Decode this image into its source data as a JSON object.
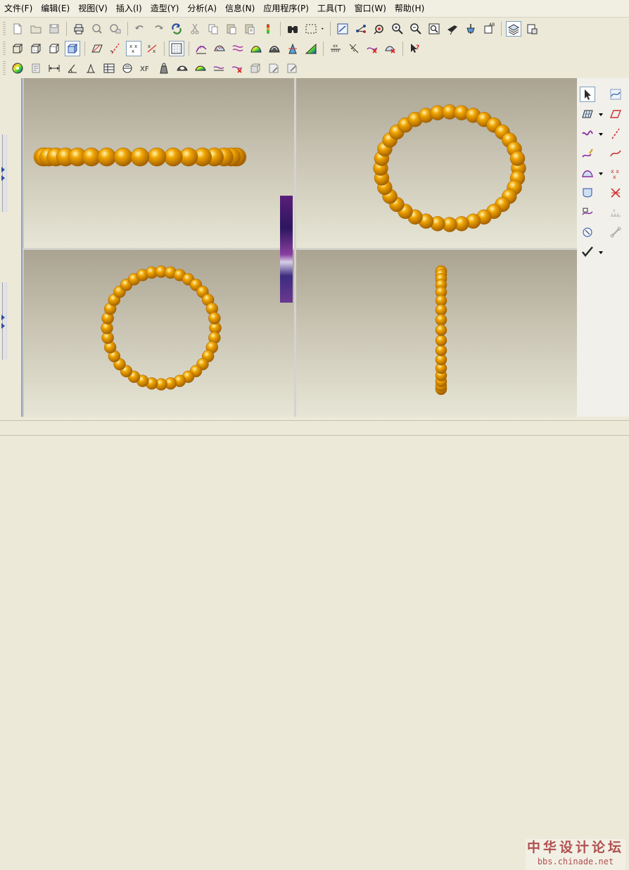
{
  "menu": [
    {
      "id": "file",
      "label": "文件(F)"
    },
    {
      "id": "edit",
      "label": "编辑(E)"
    },
    {
      "id": "view",
      "label": "视图(V)"
    },
    {
      "id": "insert",
      "label": "插入(I)"
    },
    {
      "id": "shape",
      "label": "造型(Y)"
    },
    {
      "id": "analysis",
      "label": "分析(A)"
    },
    {
      "id": "info",
      "label": "信息(N)"
    },
    {
      "id": "apps",
      "label": "应用程序(P)"
    },
    {
      "id": "tools",
      "label": "工具(T)"
    },
    {
      "id": "window",
      "label": "窗口(W)"
    },
    {
      "id": "help",
      "label": "帮助(H)"
    }
  ],
  "toolbars": [
    [
      "new-file",
      "open-folder",
      "save",
      "|",
      "print",
      "print-preview",
      "print-setup",
      "|",
      "undo",
      "redo",
      "regenerate",
      "cut",
      "copy",
      "paste",
      "paste-special",
      "model-player",
      "|",
      "binoculars",
      "selection-box",
      "dropdown",
      "|",
      "zoom-refit",
      "spin-view",
      "orient",
      "zoom-in",
      "zoom-out",
      "zoom-window",
      "fly-through",
      "datum-display",
      "named-view",
      "|",
      "layers",
      "layer-manager"
    ],
    [
      "cube-wire",
      "cube-hidden",
      "cube-nohidden",
      "cube-shaded",
      "|",
      "datum-plane",
      "datum-axis",
      "datum-points",
      "datum-points-off",
      "|",
      "grid-sketch",
      "|",
      "curve-analysis",
      "surface-analysis",
      "curvature",
      "shaded-curvature",
      "reflection",
      "draft-check",
      "slope",
      "|",
      "offset-points",
      "offset-points-off",
      "curve-cross",
      "surface-cross",
      "|",
      "whats-this"
    ],
    [
      "color-wheel",
      "scroll-note",
      "dimension",
      "angle-dim",
      "taper",
      "table-grid",
      "circle-cut",
      "xf-transform",
      "weight",
      "surf-eye",
      "surf-shade",
      "surf-analysis-2",
      "curve-delete",
      "cube-plus",
      "note-edit",
      "note-edit-2"
    ]
  ],
  "rightpanel": [
    {
      "id": "select-arrow",
      "col": 0,
      "row": 0,
      "active": true,
      "dropdown": false
    },
    {
      "id": "style-curve",
      "col": 1,
      "row": 0,
      "active": false,
      "dropdown": false
    },
    {
      "id": "surface-grid",
      "col": 0,
      "row": 1,
      "active": false,
      "dropdown": true
    },
    {
      "id": "plane-tool",
      "col": 1,
      "row": 1,
      "active": false,
      "dropdown": false
    },
    {
      "id": "wave-curve",
      "col": 0,
      "row": 2,
      "active": false,
      "dropdown": true
    },
    {
      "id": "dash-curve",
      "col": 1,
      "row": 2,
      "active": false,
      "dropdown": false
    },
    {
      "id": "pen-curve",
      "col": 0,
      "row": 3,
      "active": false,
      "dropdown": false
    },
    {
      "id": "spline-curve",
      "col": 1,
      "row": 3,
      "active": false,
      "dropdown": false
    },
    {
      "id": "boundary-surface",
      "col": 0,
      "row": 4,
      "active": false,
      "dropdown": true
    },
    {
      "id": "points-cross",
      "col": 1,
      "row": 4,
      "active": false,
      "dropdown": false
    },
    {
      "id": "loft-surface",
      "col": 0,
      "row": 5,
      "active": false,
      "dropdown": false
    },
    {
      "id": "trim-cross",
      "col": 1,
      "row": 5,
      "active": false,
      "dropdown": false
    },
    {
      "id": "curve-edit",
      "col": 0,
      "row": 6,
      "active": false,
      "dropdown": false
    },
    {
      "id": "ruler-disabled",
      "col": 1,
      "row": 6,
      "active": false,
      "dropdown": false
    },
    {
      "id": "surface-edit",
      "col": 0,
      "row": 7,
      "active": false,
      "dropdown": false
    },
    {
      "id": "link-disabled",
      "col": 1,
      "row": 7,
      "active": false,
      "dropdown": false
    },
    {
      "id": "checkmark",
      "col": 0,
      "row": 8,
      "active": false,
      "dropdown": true
    }
  ],
  "viewports": [
    {
      "id": "viewport-top-left",
      "bead_layout": "row"
    },
    {
      "id": "viewport-top-right",
      "bead_layout": "ring-large"
    },
    {
      "id": "viewport-bottom-left",
      "bead_layout": "ring"
    },
    {
      "id": "viewport-bottom-right",
      "bead_layout": "column"
    }
  ],
  "colors": {
    "bead": "#f0a400",
    "bead_highlight": "#fff6b0",
    "bead_shadow": "#a05e00",
    "viewport_top": "#aaa392",
    "viewport_bottom": "#e7e6d6",
    "accent": "#2a4fa0",
    "watermark": "#b05050"
  },
  "watermark": {
    "title": "中华设计论坛",
    "url": "bbs.chinade.net"
  }
}
